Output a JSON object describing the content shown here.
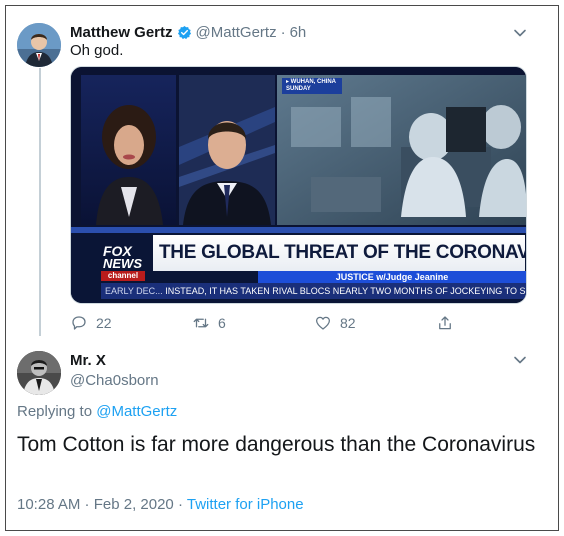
{
  "tweet": {
    "author_name": "Matthew Gertz",
    "handle": "@MattGertz",
    "time_separator": "·",
    "time": "6h",
    "text": "Oh god.",
    "verified_icon": "verified-badge-icon",
    "menu_icon": "chevron-down-icon",
    "media": {
      "location_tag_line1": "▸ WUHAN, CHINA",
      "location_tag_line2": "SUNDAY",
      "logo_line1": "FOX",
      "logo_line2": "NEWS",
      "logo_line3": "channel",
      "headline": "THE GLOBAL THREAT OF THE CORONAVIRUS",
      "show_name": "JUSTICE w/Judge Jeanine",
      "ticker_lead": "EARLY DEC...",
      "ticker_text": "INSTEAD, IT HAS TAKEN RIVAL BLOCS NEARLY TWO MONTHS OF JOCKEYING TO SELECT AI",
      "colors": {
        "headline_text": "#0e1a3c",
        "ticker_bg": "#1a2f7a",
        "logo_red": "#b91c1c"
      }
    },
    "actions": {
      "reply_count": "22",
      "retweet_count": "6",
      "like_count": "82",
      "reply_icon": "reply-bubble-icon",
      "retweet_icon": "retweet-icon",
      "like_icon": "heart-icon",
      "share_icon": "share-icon"
    }
  },
  "reply": {
    "author_name": "Mr. X",
    "handle": "@Cha0sborn",
    "replying_prefix": "Replying to",
    "replying_to": "@MattGertz",
    "text": "Tom Cotton is far more dangerous than the Coronavirus",
    "timestamp": "10:28 AM · Feb 2, 2020",
    "meta_separator": "·",
    "source": "Twitter for iPhone",
    "menu_icon": "chevron-down-icon"
  },
  "colors": {
    "link": "#1da1f2",
    "muted": "#657786",
    "text": "#14171a",
    "verified": "#1da1f2"
  }
}
